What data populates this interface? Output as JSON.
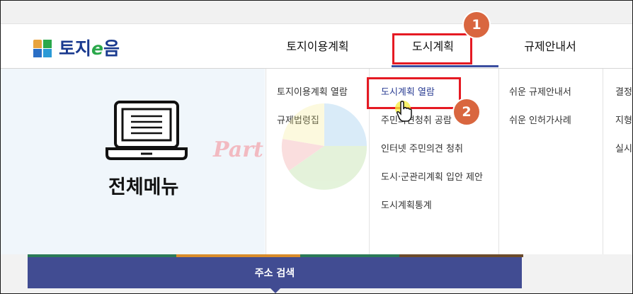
{
  "header": {
    "logo_text_prefix": "토지",
    "logo_text_e": "e",
    "logo_text_suffix": "음",
    "nav": [
      "토지이용계획",
      "도시계획",
      "규제안내서",
      ""
    ]
  },
  "all_menu": {
    "title": "전체메뉴"
  },
  "columns": [
    [
      "토지이용계획 열람",
      "규제법령집"
    ],
    [
      "도시계획 열람",
      "주민의견청취 공람",
      "인터넷 주민의견 청취",
      "도시·군관리계획 입안 제안",
      "도시계획통계"
    ],
    [
      "쉬운 규제안내서",
      "쉬운 인허가사례"
    ],
    [
      "결정",
      "지형",
      "실시"
    ]
  ],
  "callouts": {
    "badge1": "1",
    "badge2": "2"
  },
  "watermark": {
    "text": "Part"
  },
  "bottom": {
    "search_label": "주소 검색"
  },
  "colors": {
    "accent": "#414c92",
    "highlight": "#e51a23",
    "badge": "#d9663f",
    "panel": "#f0f6fb"
  }
}
